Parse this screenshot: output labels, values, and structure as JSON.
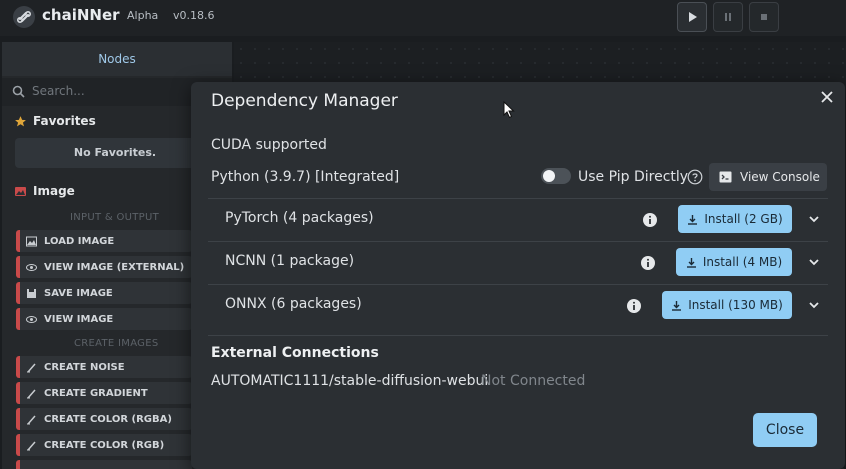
{
  "app": {
    "name": "chaiNNer",
    "tag": "Alpha",
    "version": "v0.18.6"
  },
  "sidebar": {
    "title": "Nodes",
    "search_placeholder": "Search...",
    "favorites_label": "Favorites",
    "favorites_empty": "No Favorites.",
    "category_label": "Image",
    "groups": [
      {
        "label": "INPUT & OUTPUT",
        "nodes": [
          "LOAD IMAGE",
          "VIEW IMAGE (EXTERNAL)",
          "SAVE IMAGE",
          "VIEW IMAGE"
        ]
      },
      {
        "label": "CREATE IMAGES",
        "nodes": [
          "CREATE NOISE",
          "CREATE GRADIENT",
          "CREATE COLOR (RGBA)",
          "CREATE COLOR (RGB)"
        ]
      }
    ],
    "accent_color": "#c94a4a"
  },
  "modal": {
    "title": "Dependency Manager",
    "cuda_status": "CUDA supported",
    "python_info": "Python (3.9.7) [Integrated]",
    "pip_toggle_label": "Use Pip Directly",
    "view_console_label": "View Console",
    "dependencies": [
      {
        "name": "PyTorch (4 packages)",
        "install_label": "Install (2 GB)"
      },
      {
        "name": "NCNN (1 package)",
        "install_label": "Install (4 MB)"
      },
      {
        "name": "ONNX (6 packages)",
        "install_label": "Install (130 MB)"
      }
    ],
    "external_title": "External Connections",
    "external_name": "AUTOMATIC1111/stable-diffusion-webui",
    "external_status": "Not Connected",
    "close_label": "Close",
    "accent_color": "#90cdf4"
  }
}
